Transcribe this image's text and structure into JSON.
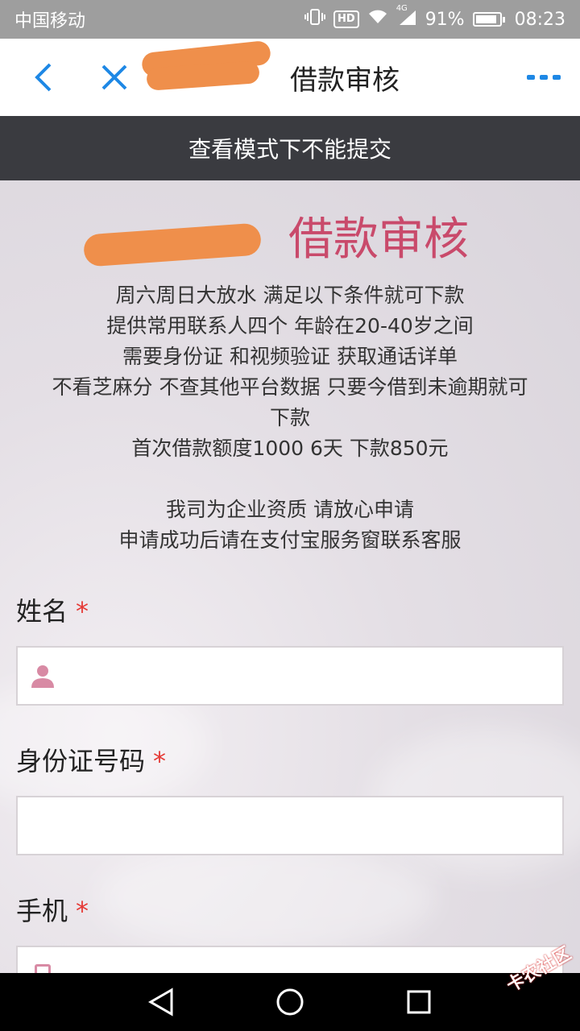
{
  "status": {
    "carrier": "中国移动",
    "hd": "HD",
    "network": "4G",
    "battery_pct_text": "91%",
    "battery_level": 0.91,
    "time": "08:23"
  },
  "navbar": {
    "title": "借款审核",
    "accent": "#1e88e5"
  },
  "notice": {
    "text": "查看模式下不能提交"
  },
  "hero": {
    "title": "借款审核",
    "color": "#c94a6b"
  },
  "description": {
    "lines": [
      "周六周日大放水 满足以下条件就可下款",
      "提供常用联系人四个  年龄在20-40岁之间",
      "需要身份证 和视频验证 获取通话详单",
      "不看芝麻分 不查其他平台数据 只要今借到未逾期就可",
      "下款",
      "首次借款额度1000  6天  下款850元",
      "",
      "我司为企业资质 请放心申请",
      "申请成功后请在支付宝服务窗联系客服"
    ]
  },
  "form": {
    "required_mark": "*",
    "fields": [
      {
        "label": "姓名",
        "icon": "user-icon",
        "value": ""
      },
      {
        "label": "身份证号码",
        "icon": "",
        "value": ""
      },
      {
        "label": "手机",
        "icon": "phone-icon",
        "value": ""
      }
    ]
  },
  "watermark": {
    "text": "卡农社区"
  }
}
